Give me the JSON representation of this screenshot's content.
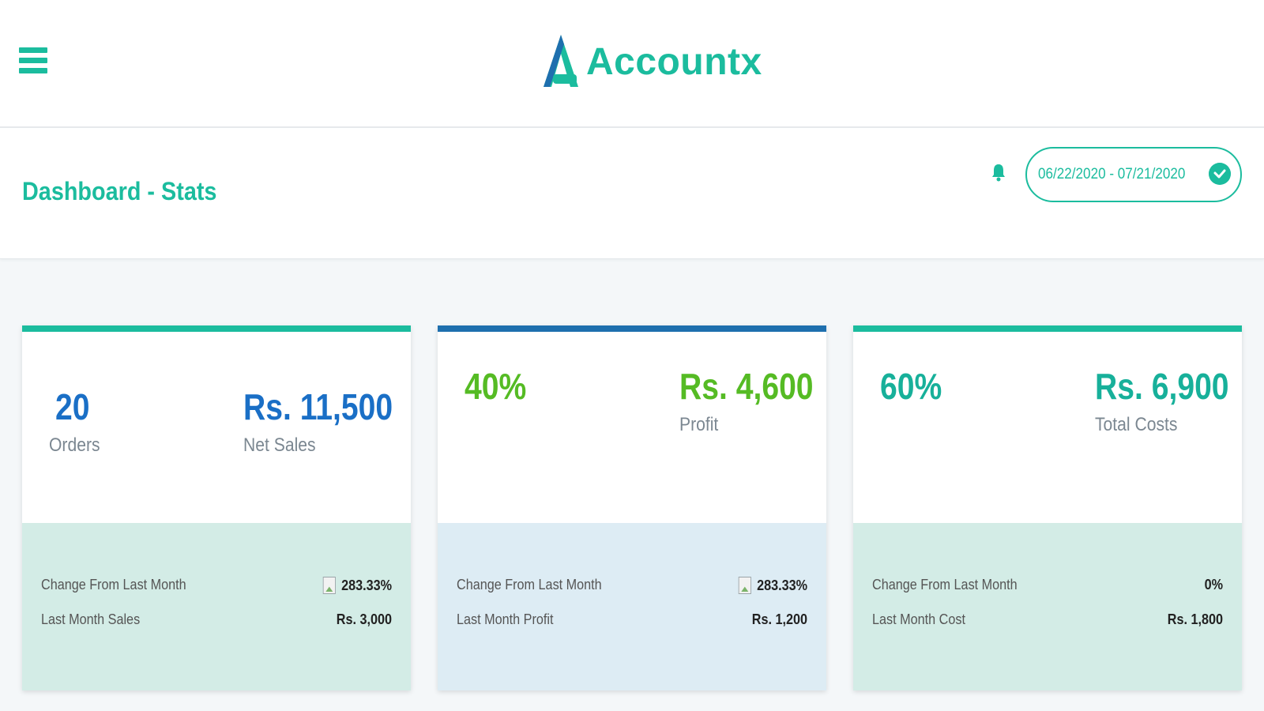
{
  "app": {
    "name": "Accountx"
  },
  "page": {
    "title": "Dashboard - Stats"
  },
  "filter": {
    "date_range": "06/22/2020 - 07/21/2020"
  },
  "colors": {
    "accent": "#1bbc9e",
    "blue": "#1a6fc6",
    "green": "#55bb24",
    "dark_blue_bar": "#1e6fae"
  },
  "cards": [
    {
      "left_value": "20",
      "left_label": "Orders",
      "right_value": "Rs. 11,500",
      "right_label": "Net Sales",
      "change_label": "Change From Last Month",
      "change_value": "283.33%",
      "last_label": "Last Month Sales",
      "last_value": "Rs. 3,000"
    },
    {
      "left_value": "40%",
      "right_value": "Rs. 4,600",
      "right_label": "Profit",
      "change_label": "Change From Last Month",
      "change_value": "283.33%",
      "last_label": "Last Month Profit",
      "last_value": "Rs. 1,200"
    },
    {
      "left_value": "60%",
      "right_value": "Rs. 6,900",
      "right_label": "Total Costs",
      "change_label": "Change From Last Month",
      "change_value": "0%",
      "last_label": "Last Month Cost",
      "last_value": "Rs. 1,800"
    }
  ],
  "icons": [
    "menu-icon",
    "bell-icon",
    "check-circle-icon",
    "trend-icon"
  ]
}
